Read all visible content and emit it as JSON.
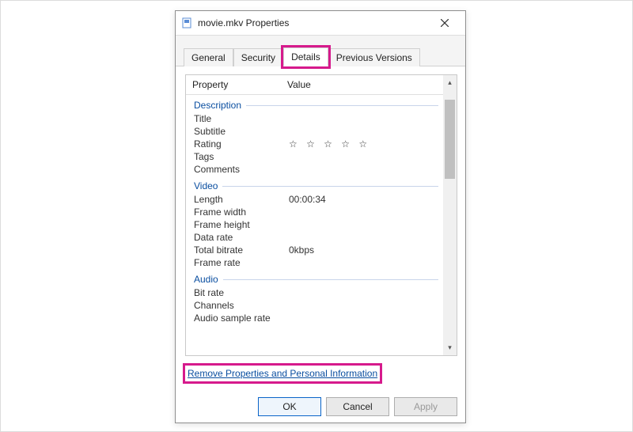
{
  "titlebar": {
    "title": "movie.mkv Properties"
  },
  "tabs": {
    "general": "General",
    "security": "Security",
    "details": "Details",
    "previous": "Previous Versions"
  },
  "columns": {
    "property": "Property",
    "value": "Value"
  },
  "groups": {
    "description": "Description",
    "video": "Video",
    "audio": "Audio"
  },
  "rows": {
    "title": {
      "label": "Title",
      "value": ""
    },
    "subtitle": {
      "label": "Subtitle",
      "value": ""
    },
    "rating": {
      "label": "Rating",
      "stars": "☆ ☆ ☆ ☆ ☆"
    },
    "tags": {
      "label": "Tags",
      "value": ""
    },
    "comments": {
      "label": "Comments",
      "value": ""
    },
    "length": {
      "label": "Length",
      "value": "00:00:34"
    },
    "frame_width": {
      "label": "Frame width",
      "value": ""
    },
    "frame_height": {
      "label": "Frame height",
      "value": ""
    },
    "data_rate": {
      "label": "Data rate",
      "value": ""
    },
    "total_bitrate": {
      "label": "Total bitrate",
      "value": "0kbps"
    },
    "frame_rate": {
      "label": "Frame rate",
      "value": ""
    },
    "bit_rate": {
      "label": "Bit rate",
      "value": ""
    },
    "channels": {
      "label": "Channels",
      "value": ""
    },
    "audio_sample_rate": {
      "label": "Audio sample rate",
      "value": ""
    }
  },
  "remove_link": "Remove Properties and Personal Information",
  "buttons": {
    "ok": "OK",
    "cancel": "Cancel",
    "apply": "Apply"
  }
}
